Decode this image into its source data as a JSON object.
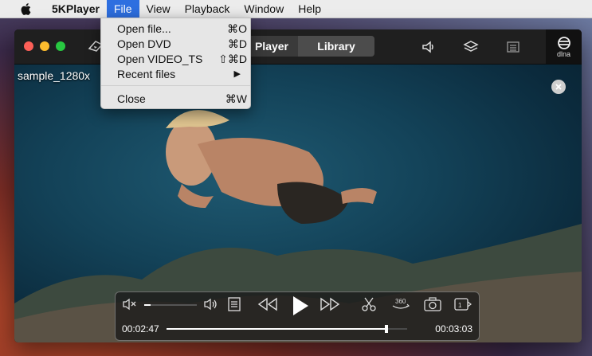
{
  "menubar": {
    "app_name": "5KPlayer",
    "items": [
      "File",
      "View",
      "Playback",
      "Window",
      "Help"
    ],
    "active": "File"
  },
  "file_menu": {
    "items": [
      {
        "label": "Open file...",
        "shortcut": "⌘O"
      },
      {
        "label": "Open DVD",
        "shortcut": "⌘D"
      },
      {
        "label": "Open VIDEO_TS",
        "shortcut": "⇧⌘D"
      },
      {
        "label": "Recent files",
        "shortcut": "▶"
      },
      {
        "label": "Close",
        "shortcut": "⌘W"
      }
    ]
  },
  "window": {
    "tabs": {
      "player": "Player",
      "library": "Library"
    },
    "dlna_label": "dlna"
  },
  "video": {
    "filename": "sample_1280x"
  },
  "controls": {
    "current_time": "00:02:47",
    "total_time": "00:03:03",
    "progress": 0.914,
    "volume": 0.12
  },
  "colors": {
    "accent": "#2e6fe0",
    "menubar_bg": "#ececec",
    "titlebar_bg": "#1f1f1f"
  }
}
